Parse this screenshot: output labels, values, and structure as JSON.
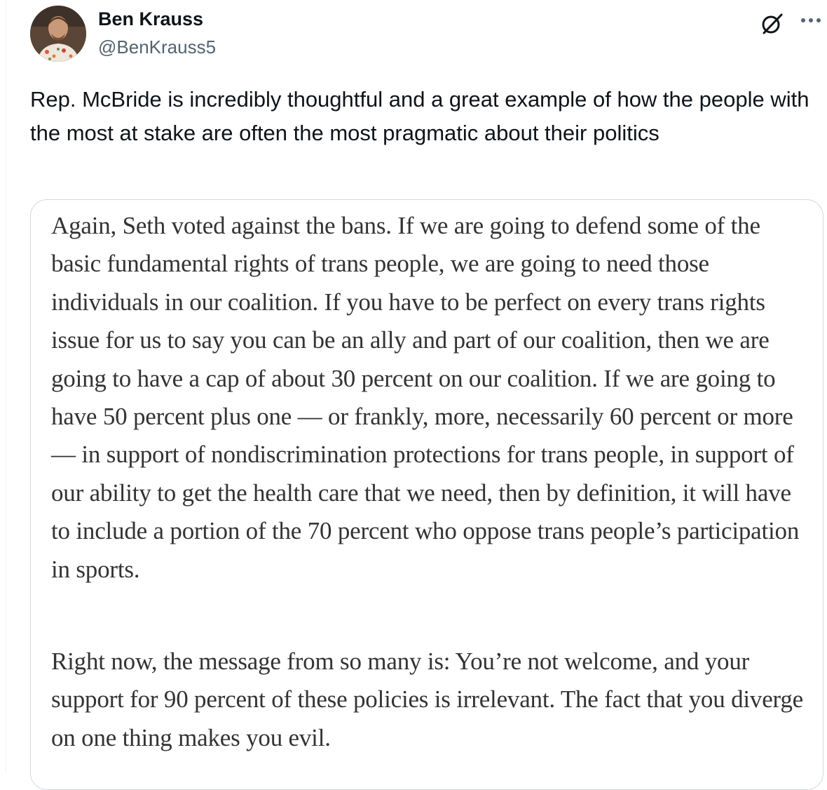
{
  "author": {
    "name": "Ben Krauss",
    "handle": "@BenKrauss5",
    "avatar_icon": "profile-photo"
  },
  "header_icons": {
    "grok": "grok-icon",
    "more": "more-options-icon"
  },
  "tweet": {
    "text": "Rep. McBride is incredibly thoughtful and a great example of how the people with the most at stake are often the most pragmatic about their politics"
  },
  "quote_image": {
    "paragraphs": [
      "Again, Seth voted against the bans. If we are going to defend some of the basic fundamental rights of trans people, we are going to need those individuals in our coalition. If you have to be perfect on every trans rights issue for us to say you can be an ally and part of our coalition, then we are going to have a cap of about 30 percent on our coalition. If we are going to have 50 percent plus one — or frankly, more, necessarily 60 percent or more — in support of nondiscrimination protections for trans people, in support of our ability to get the health care that we need, then by definition, it will have to include a portion of the 70 percent who oppose trans people’s participation in sports.",
      "Right now, the message from so many is: You’re not welcome, and your support for 90 percent of these policies is irrelevant. The fact that you diverge on one thing makes you evil."
    ]
  },
  "colors": {
    "text_primary": "#0f1419",
    "text_secondary": "#536471",
    "quote_text": "#333333",
    "card_border": "#cfd9de"
  }
}
